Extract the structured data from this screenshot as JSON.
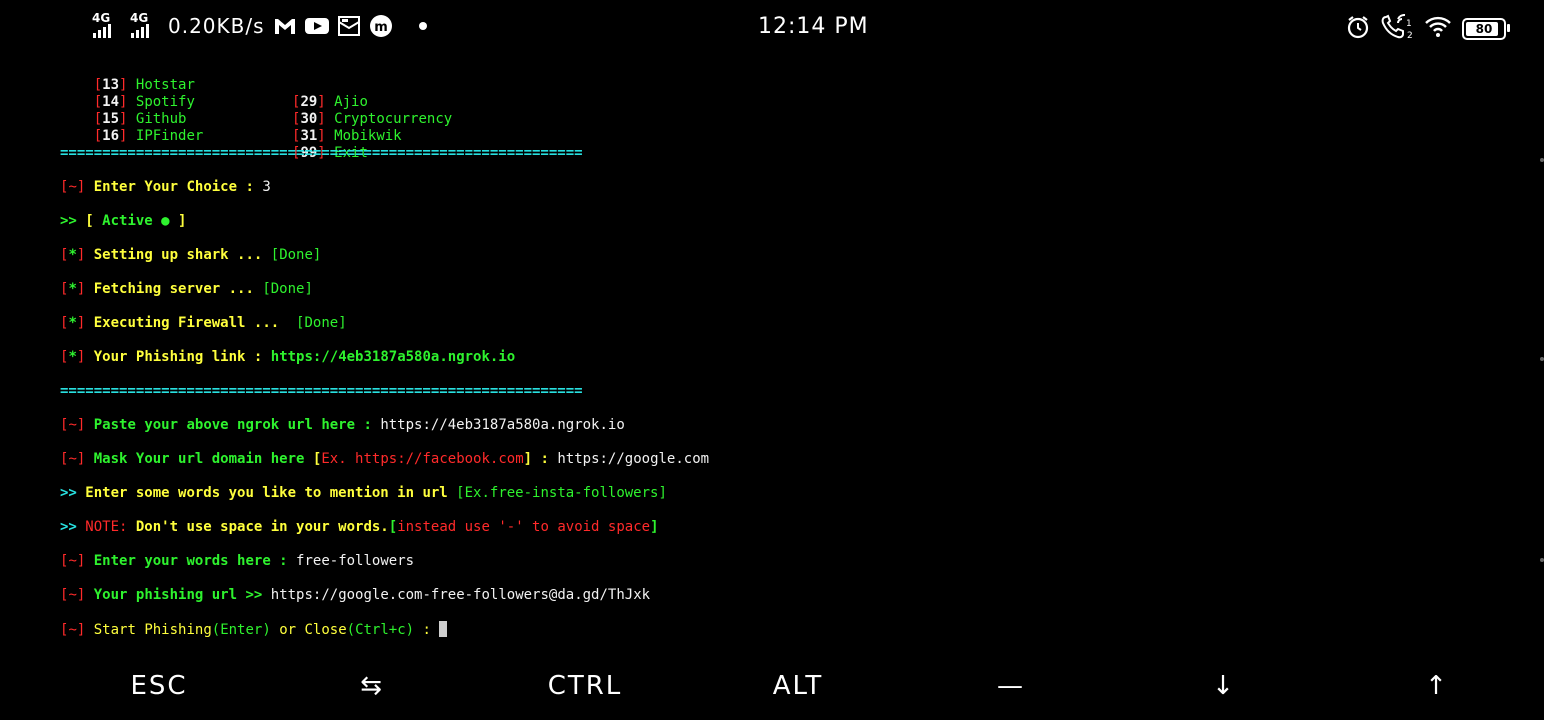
{
  "status_bar": {
    "sim1": "4G",
    "sim2": "4G",
    "speed": "0.20KB/s",
    "time": "12:14 PM",
    "battery": "80"
  },
  "menu": [
    {
      "num": "13",
      "name": "Hotstar"
    },
    {
      "num": "14",
      "name": "Spotify"
    },
    {
      "num": "15",
      "name": "Github"
    },
    {
      "num": "16",
      "name": "IPFinder"
    },
    {
      "num": "29",
      "name": "Ajio"
    },
    {
      "num": "30",
      "name": "Cryptocurrency"
    },
    {
      "num": "31",
      "name": "Mobikwik"
    },
    {
      "num": "99",
      "name": "Exit"
    }
  ],
  "separator": "==============================================================",
  "lines": {
    "choice_label": "Enter Your Choice : ",
    "choice_value": "3",
    "active_prefix": ">> ",
    "active_open": "[ ",
    "active_text": "Active ● ",
    "active_close": "]",
    "setup": "Setting up shark ... ",
    "fetch": "Fetching server ... ",
    "firewall": "Executing Firewall ...  ",
    "done": "[Done]",
    "phish_label": "Your Phishing link : ",
    "phish_link": "https://4eb3187a580a.ngrok.io",
    "paste_label": "Paste your above ngrok url here : ",
    "paste_value": "https://4eb3187a580a.ngrok.io",
    "mask_label": "Mask Your url domain here ",
    "mask_ex_open": "[",
    "mask_ex": "Ex. https://facebook.com",
    "mask_ex_close": "] : ",
    "mask_value": "https://google.com",
    "words_prefix": ">> ",
    "words_label": "Enter some words you like to mention in url ",
    "words_ex": "[Ex.free-insta-followers]",
    "note_prefix": ">> ",
    "note_label": "NOTE: ",
    "note_text": "Don't use space in your words.",
    "note_bracket_open": "[",
    "note_ex": "instead use '-' to avoid space",
    "note_bracket_close": "]",
    "words_here_label": "Enter your words here : ",
    "words_here_value": "free-followers",
    "url_label": "Your phishing url >> ",
    "url_value": "https://google.com-free-followers@da.gd/ThJxk",
    "start_label": "Start Phishing",
    "start_enter": "(Enter)",
    "start_or": " or Close",
    "start_ctrl": "(Ctrl+c)",
    "start_colon": " : "
  },
  "tags": {
    "tilde": "~",
    "star": "*"
  },
  "extra_keys": [
    "ESC",
    "⇆",
    "CTRL",
    "ALT",
    "—",
    "↓",
    "↑"
  ]
}
